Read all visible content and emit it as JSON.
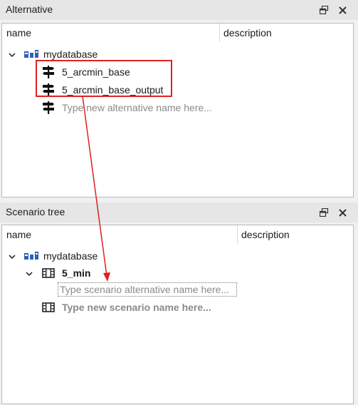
{
  "alternative_dock": {
    "title": "Alternative",
    "columns": {
      "name": "name",
      "description": "description"
    },
    "root": "mydatabase",
    "items": [
      "5_arcmin_base",
      "5_arcmin_base_output"
    ],
    "new_placeholder": "Type new alternative name here..."
  },
  "scenario_dock": {
    "title": "Scenario tree",
    "columns": {
      "name": "name",
      "description": "description"
    },
    "root": "mydatabase",
    "scenario": "5_min",
    "alt_placeholder": "Type scenario alternative name here...",
    "new_placeholder": "Type new scenario name here..."
  },
  "colors": {
    "annotation": "#e02020",
    "database_icon": "#2e5fb5",
    "placeholder_text": "#8a8a8a"
  }
}
